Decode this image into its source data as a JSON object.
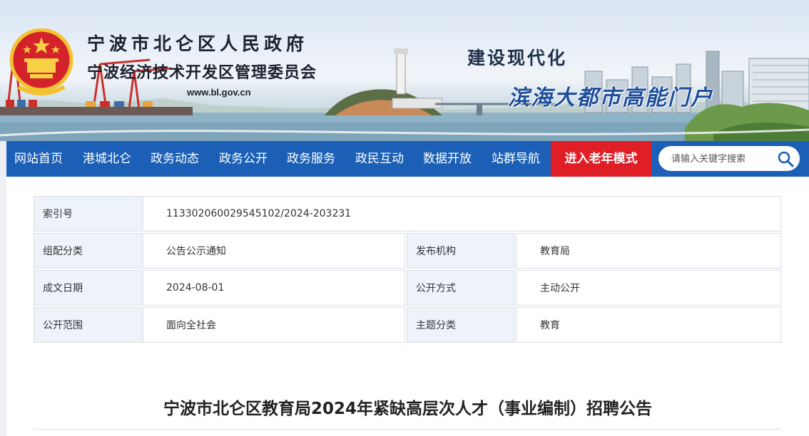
{
  "header": {
    "title_line1": "宁波市北仑区人民政府",
    "title_line2": "宁波经济技术开发区管理委员会",
    "url": "www.bl.gov.cn",
    "slogan_line1": "建设现代化",
    "slogan_line2": "滨海大都市高能门户"
  },
  "nav": {
    "items": [
      "网站首页",
      "港城北仑",
      "政务动态",
      "政务公开",
      "政务服务",
      "政民互动",
      "数据开放",
      "站群导航"
    ],
    "elder_mode": "进入老年模式",
    "search_placeholder": "请输入关键字搜索"
  },
  "info": {
    "index_label": "索引号",
    "index_value": "11330206002954510 2/2024-203231",
    "category_label": "组配分类",
    "category_value": "公告公示通知",
    "publisher_label": "发布机构",
    "publisher_value": "教育局",
    "date_label": "成文日期",
    "date_value": "2024-08-01",
    "open_mode_label": "公开方式",
    "open_mode_value": "主动公开",
    "scope_label": "公开范围",
    "scope_value": "面向全社会",
    "topic_label": "主题分类",
    "topic_value": "教育"
  },
  "document": {
    "title": "宁波市北仑区教育局2024年紧缺高层次人才（事业编制）招聘公告"
  },
  "colors": {
    "nav_blue": "#1b60b6",
    "elder_red": "#e01e26",
    "label_bg": "#eef3fa"
  }
}
